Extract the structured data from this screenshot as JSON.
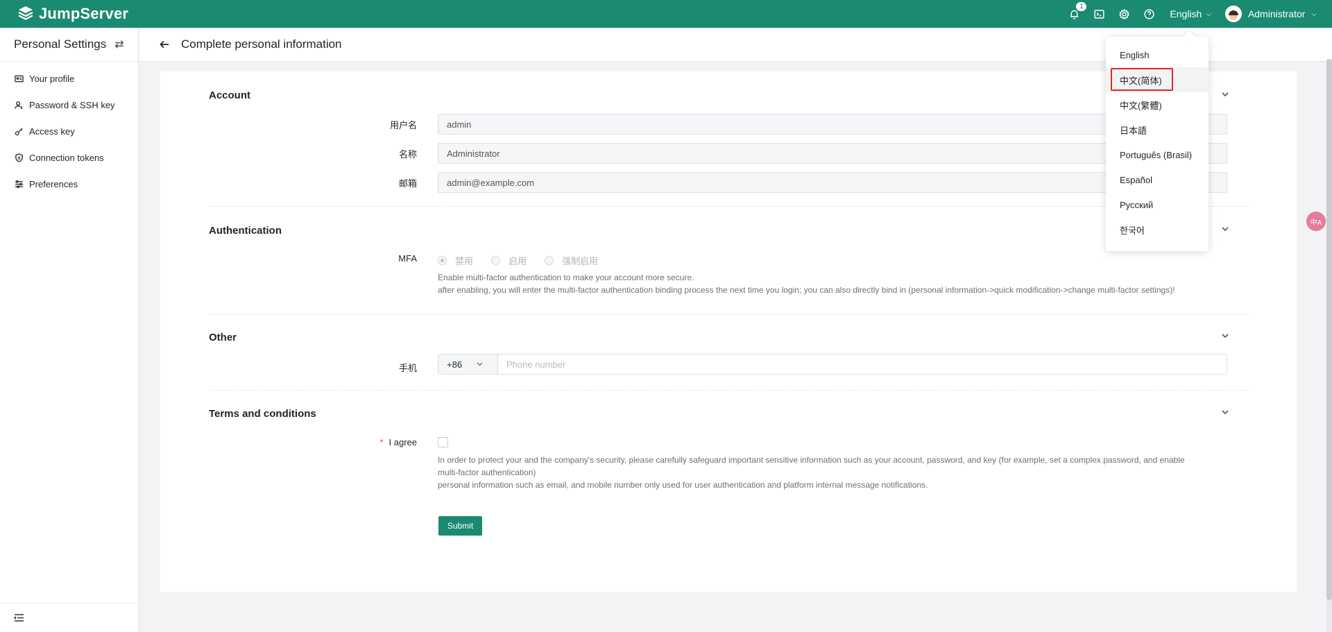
{
  "topbar": {
    "brand": "JumpServer",
    "notification_count": "1",
    "language": "English",
    "user_name": "Administrator"
  },
  "sidebar": {
    "title": "Personal Settings",
    "items": [
      {
        "label": "Your profile",
        "icon": "profile-card-icon"
      },
      {
        "label": "Password & SSH key",
        "icon": "user-key-icon"
      },
      {
        "label": "Access key",
        "icon": "key-icon"
      },
      {
        "label": "Connection tokens",
        "icon": "shield-icon"
      },
      {
        "label": "Preferences",
        "icon": "sliders-icon"
      }
    ]
  },
  "page": {
    "title": "Complete personal information"
  },
  "form": {
    "account": {
      "title": "Account",
      "username_label": "用户名",
      "username_value": "admin",
      "name_label": "名称",
      "name_value": "Administrator",
      "email_label": "邮箱",
      "email_value": "admin@example.com"
    },
    "authentication": {
      "title": "Authentication",
      "mfa_label": "MFA",
      "mfa_options": [
        "禁用",
        "启用",
        "强制启用"
      ],
      "mfa_selected": "禁用",
      "help_line1": "Enable multi-factor authentication to make your account more secure.",
      "help_line2": "after enabling, you will enter the multi-factor authentication binding process the next time you login; you can also directly bind in (personal information->quick modification->change multi-factor settings)!"
    },
    "other": {
      "title": "Other",
      "phone_label": "手机",
      "phone_code": "+86",
      "phone_placeholder": "Phone number"
    },
    "terms": {
      "title": "Terms and conditions",
      "required_mark": "*",
      "agree_label": "I agree",
      "text_line1": "In order to protect your and the company's security, please carefully safeguard important sensitive information such as your account, password, and key (for example, set a complex password, and enable",
      "text_line2": "multi-factor authentication)",
      "text_line3": "personal information such as email, and mobile number only used for user authentication and platform internal message notifications."
    },
    "submit_label": "Submit"
  },
  "language_menu": {
    "options": [
      "English",
      "中文(简体)",
      "中文(繁體)",
      "日本語",
      "Português (Brasil)",
      "Español",
      "Русский",
      "한국어"
    ],
    "highlighted": "中文(简体)"
  },
  "float_translate_text": "中A",
  "colors": {
    "brand": "#1a8a70",
    "highlight_border": "#e8261c"
  }
}
